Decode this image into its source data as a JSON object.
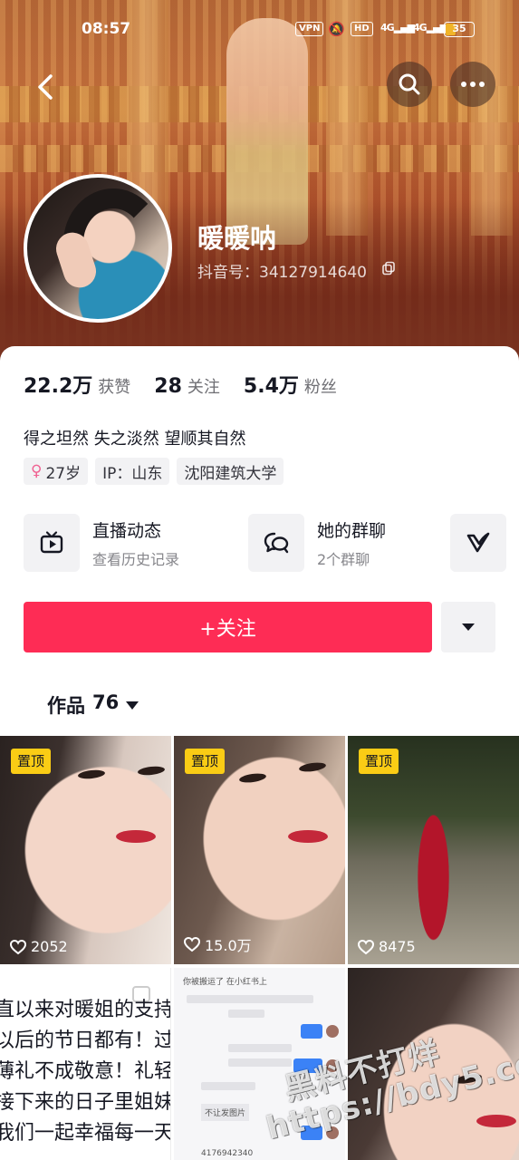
{
  "status_bar": {
    "time": "08:57",
    "vpn": "VPN",
    "hd": "HD",
    "signal1": "4G",
    "signal2": "4G",
    "battery": "35",
    "battery_level": 0.35
  },
  "profile": {
    "nickname": "暖暖呐",
    "douyin_id": "抖音号：34127914640"
  },
  "stats": [
    {
      "value": "22.2万",
      "label": "获赞"
    },
    {
      "value": "28",
      "label": "关注"
    },
    {
      "value": "5.4万",
      "label": "粉丝"
    }
  ],
  "bio": "得之坦然 失之淡然 望顺其自然",
  "tags": {
    "age": "27岁",
    "ip": "IP：山东",
    "school": "沈阳建筑大学"
  },
  "entries": {
    "live": {
      "title": "直播动态",
      "sub": "查看历史记录"
    },
    "group": {
      "title": "她的群聊",
      "sub": "2个群聊"
    }
  },
  "actions": {
    "follow": "+关注"
  },
  "works_tab": {
    "label": "作品",
    "count": "76"
  },
  "videos": [
    {
      "pinned": "置顶",
      "likes": "2052"
    },
    {
      "pinned": "置顶",
      "likes": "15.0万"
    },
    {
      "pinned": "置顶",
      "likes": "8475"
    }
  ],
  "text_post": {
    "lines": [
      "直以来对暖姐的支持",
      "以后的节日都有！过",
      "薄礼不成敬意！礼轻",
      "接下来的日子里姐妹",
      "我们一起幸福每一天"
    ]
  },
  "chat_post": {
    "top": "你被搬运了 在小红书上",
    "bottom_tag": "不让发图片",
    "bottom_num": "4176942340"
  },
  "watermark": {
    "line1": "黑料不打烊",
    "line2": "https://bdy5.co"
  },
  "colors": {
    "accent": "#fe2c55",
    "pin": "#facc15"
  },
  "icons": [
    "back-arrow-icon",
    "search-icon",
    "more-icon",
    "copy-icon",
    "female-icon",
    "tv-icon",
    "chat-icon",
    "v-logo-icon",
    "triangle-down-icon",
    "heart-icon"
  ]
}
